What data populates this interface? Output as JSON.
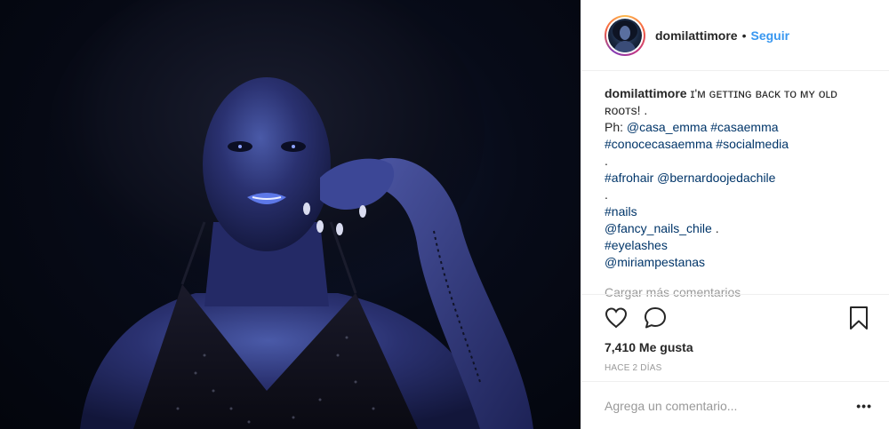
{
  "post": {
    "username": "domilattimore",
    "separator": "•",
    "follow_label": "Seguir"
  },
  "caption": {
    "username": "domilattimore",
    "text_line1": "ɪ'ᴍ ɢᴇᴛᴛɪɴɢ ʙᴀᴄᴋ ᴛᴏ ᴍʏ ᴏʟᴅ",
    "text_line2": "ʀᴏᴏᴛs! .",
    "ph_prefix": "Ph: ",
    "ph_mention": "@casa_emma",
    "ph_tag": "#casaemma",
    "tag_conoce": "#conocecasaemma",
    "tag_social": "#socialmedia",
    "dot1": ".",
    "tag_afro": "#afrohair",
    "mention_bernardo": "@bernardoojedachile",
    "dot2": ".",
    "tag_nails": "#nails",
    "mention_fancy": "@fancy_nails_chile",
    "fancy_suffix": " .",
    "tag_eyelashes": "#eyelashes",
    "mention_miriam": "@miriampestanas",
    "load_more": "Cargar más comentarios"
  },
  "actions": {
    "like_icon": "heart-icon",
    "comment_icon": "speech-bubble-icon",
    "save_icon": "bookmark-icon"
  },
  "likes": "7,410 Me gusta",
  "timestamp": "Hace 2 días",
  "comment": {
    "placeholder": "Agrega un comentario...",
    "options_label": "•••"
  },
  "colors": {
    "link": "#003569",
    "follow": "#3897f0",
    "muted": "#999999",
    "border": "#efefef",
    "text": "#262626"
  }
}
